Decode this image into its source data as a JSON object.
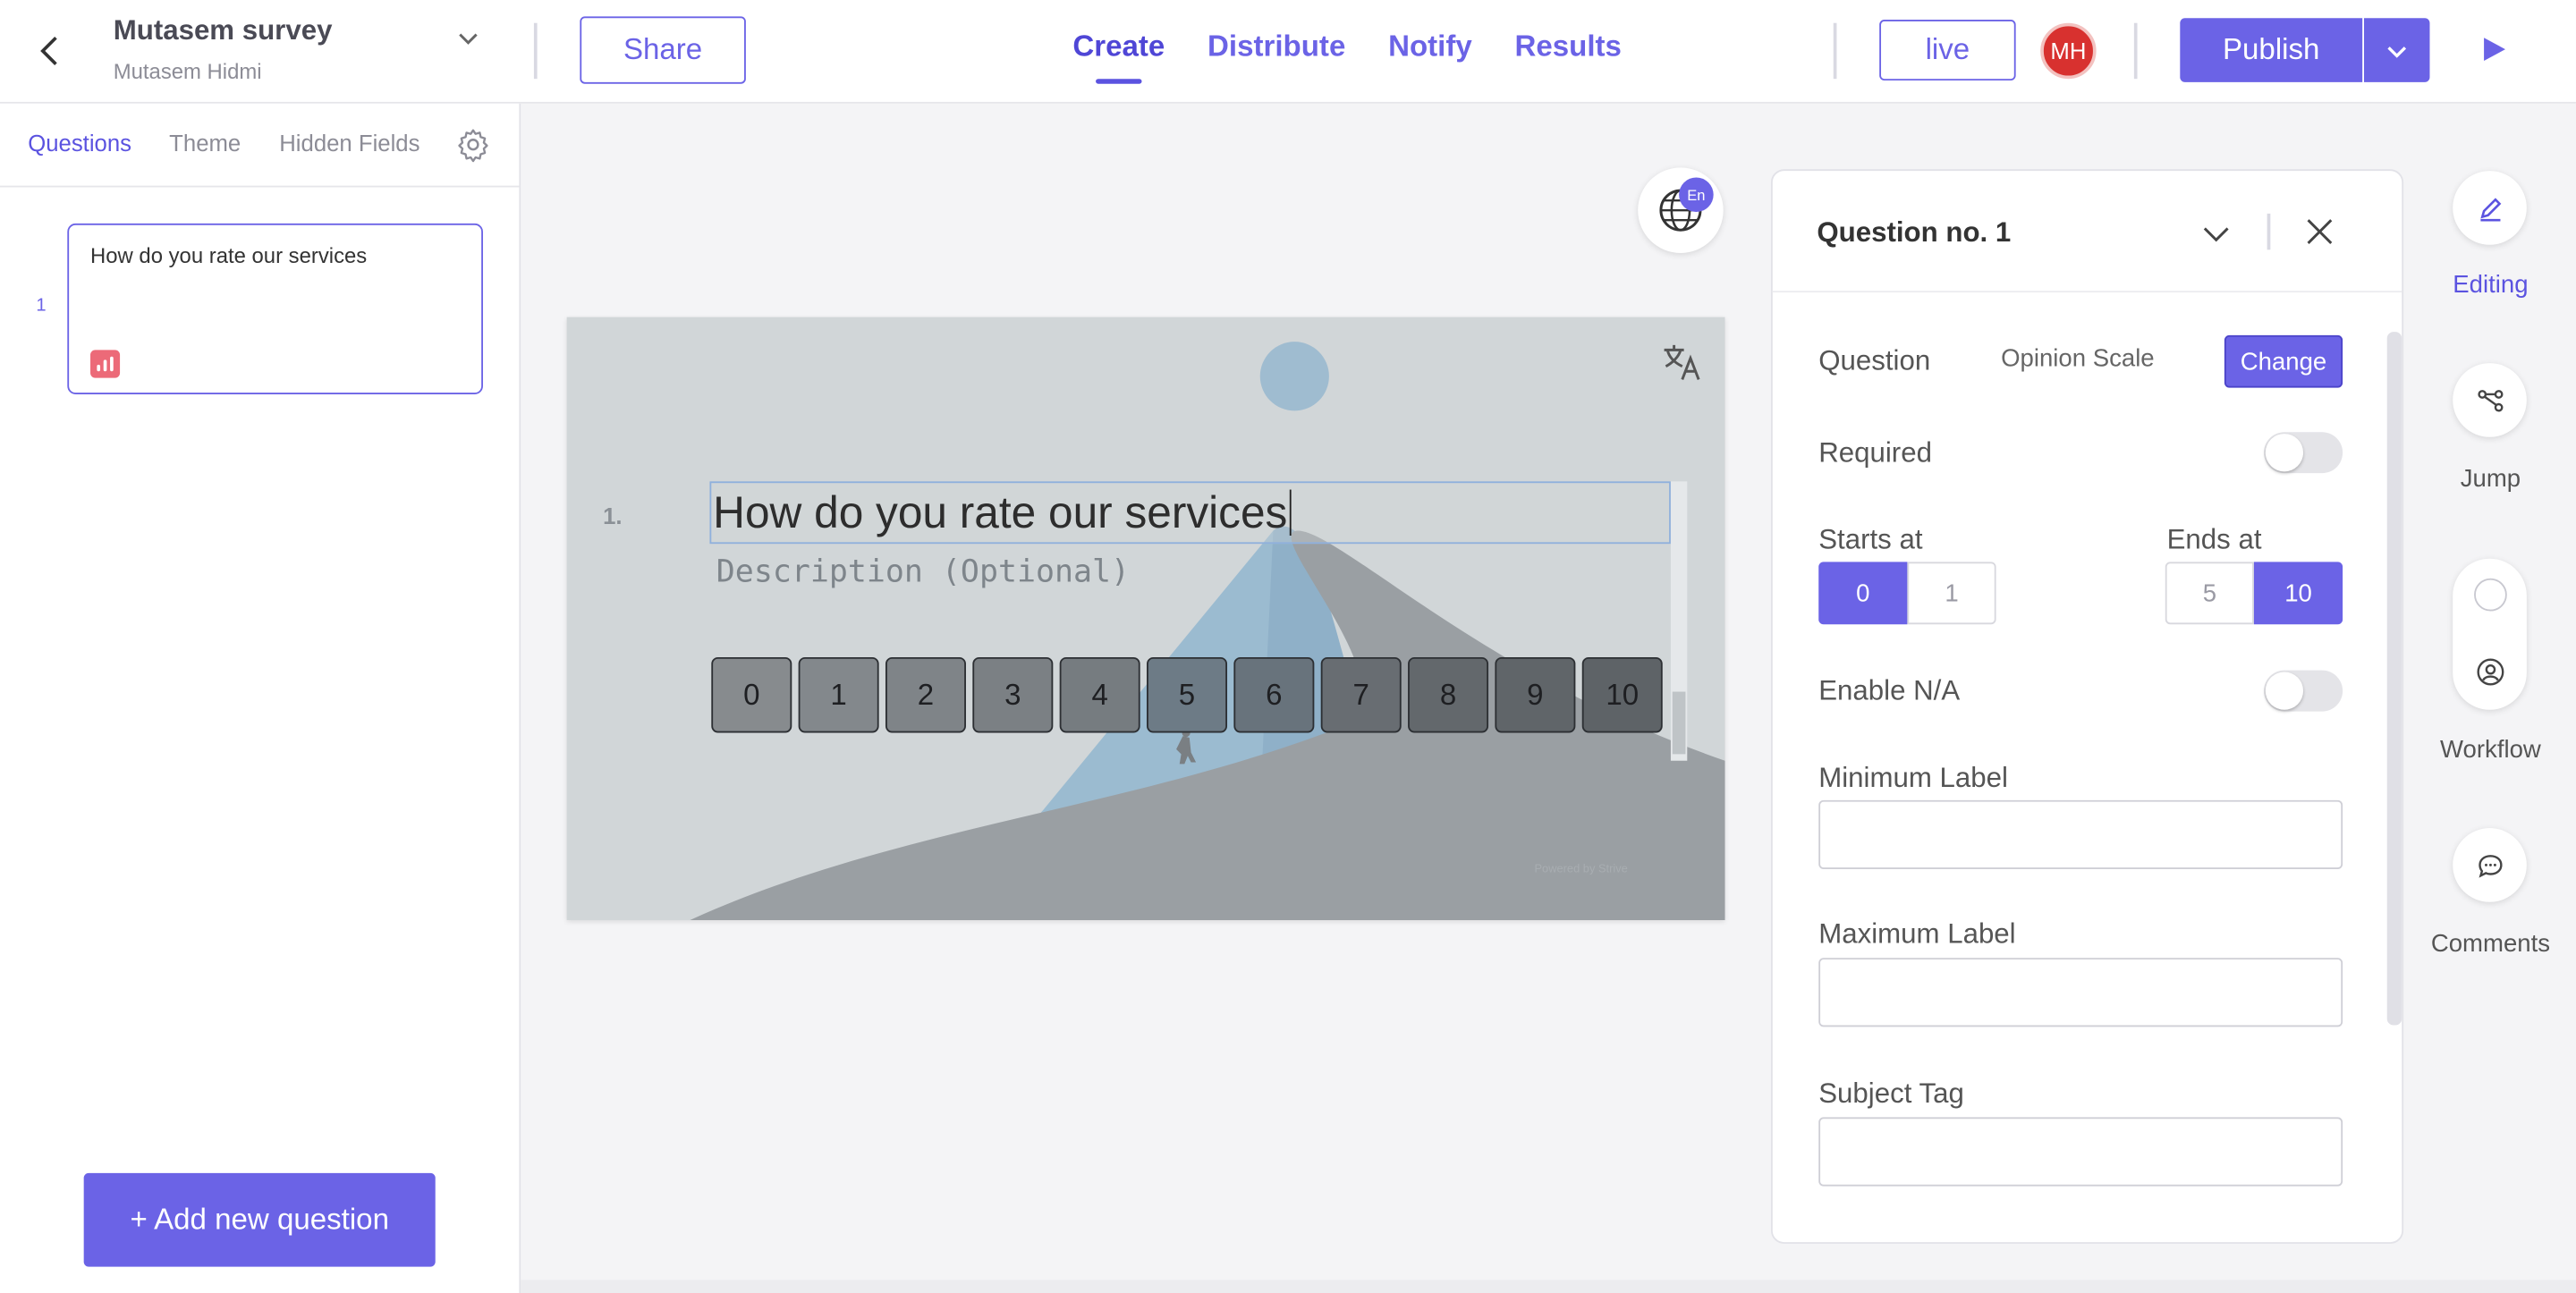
{
  "header": {
    "survey_title": "Mutasem survey",
    "survey_owner": "Mutasem Hidmi",
    "share_label": "Share",
    "tabs": [
      {
        "label": "Create",
        "active": true
      },
      {
        "label": "Distribute",
        "active": false
      },
      {
        "label": "Notify",
        "active": false
      },
      {
        "label": "Results",
        "active": false
      }
    ],
    "live_label": "live",
    "avatar_initials": "MH",
    "publish_label": "Publish"
  },
  "sidebar": {
    "tabs": [
      {
        "label": "Questions",
        "active": true
      },
      {
        "label": "Theme",
        "active": false
      },
      {
        "label": "Hidden Fields",
        "active": false
      }
    ],
    "questions": [
      {
        "number": "1",
        "text": "How do you rate our services",
        "type_icon": "opinion-scale-icon"
      }
    ],
    "add_button_label": "+ Add new question"
  },
  "canvas": {
    "language_badge": "En",
    "question_number": "1.",
    "question_text": "How do you rate our services",
    "description_placeholder": "Description (Optional)",
    "scale_values": [
      "0",
      "1",
      "2",
      "3",
      "4",
      "5",
      "6",
      "7",
      "8",
      "9",
      "10"
    ],
    "powered_by": "Powered by Strive"
  },
  "properties": {
    "title": "Question no. 1",
    "question_label": "Question",
    "question_type": "Opinion Scale",
    "change_label": "Change",
    "required_label": "Required",
    "required_on": false,
    "starts_at_label": "Starts at",
    "starts_at_options": [
      "0",
      "1"
    ],
    "starts_at_selected": "0",
    "ends_at_label": "Ends at",
    "ends_at_options": [
      "5",
      "10"
    ],
    "ends_at_selected": "10",
    "enable_na_label": "Enable N/A",
    "enable_na_on": false,
    "min_label_label": "Minimum Label",
    "min_label_value": "",
    "max_label_label": "Maximum Label",
    "max_label_value": "",
    "subject_tag_label": "Subject Tag",
    "subject_tag_value": ""
  },
  "rail": {
    "editing_label": "Editing",
    "jump_label": "Jump",
    "workflow_label": "Workflow",
    "comments_label": "Comments"
  },
  "colors": {
    "accent": "#6b63e6",
    "avatar": "#d8312f",
    "question_icon": "#ec6a78"
  }
}
